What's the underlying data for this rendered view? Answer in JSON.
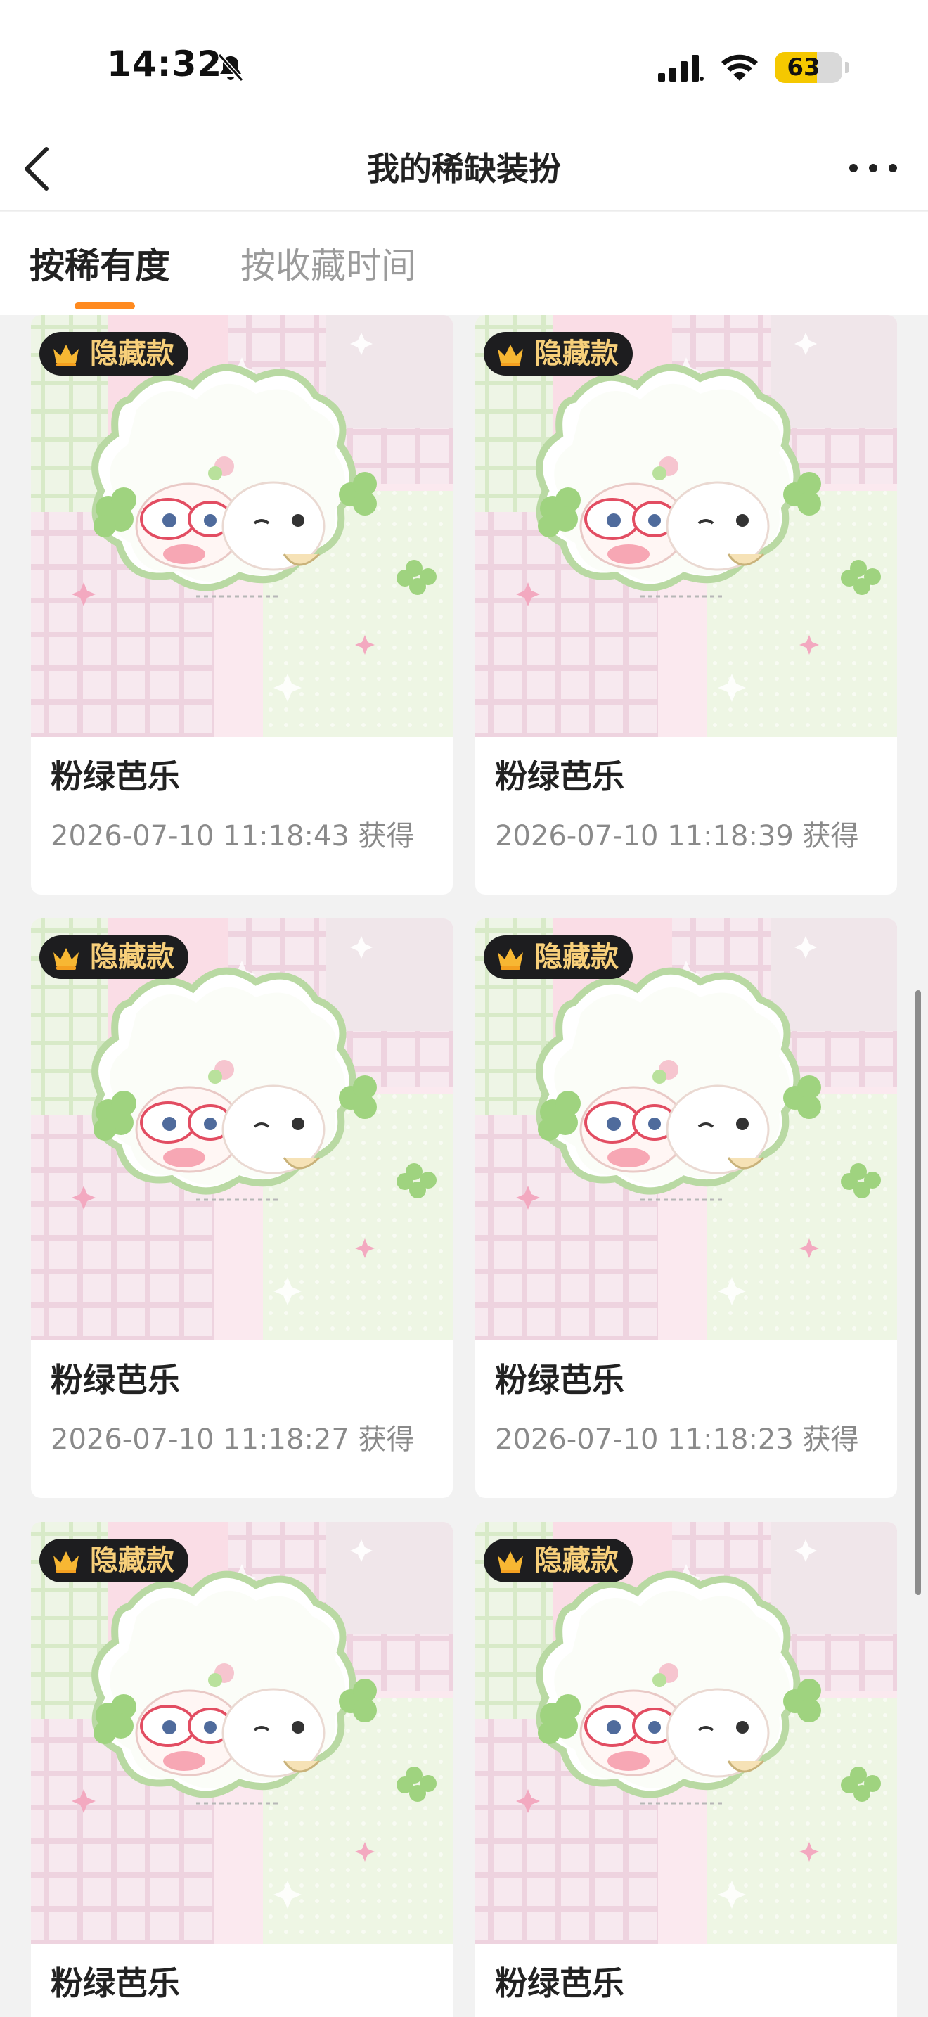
{
  "status_bar": {
    "time": "14:32",
    "battery": "63",
    "battery_level": 0.63,
    "icons": [
      "bell-slash-icon",
      "signal-icon",
      "wifi-icon",
      "battery-icon"
    ]
  },
  "nav": {
    "title": "我的稀缺装扮",
    "back_icon": "chevron-left-icon",
    "more_icon": "more-horizontal-icon"
  },
  "tabs": [
    {
      "label": "按稀有度",
      "active": true
    },
    {
      "label": "按收藏时间",
      "active": false
    }
  ],
  "accent_color": "#ff8a1f",
  "badge_color": "#f7cf7a",
  "items": [
    {
      "badge": "隐藏款",
      "name": "粉绿芭乐",
      "date": "2026-07-10 11:18:43 获得"
    },
    {
      "badge": "隐藏款",
      "name": "粉绿芭乐",
      "date": "2026-07-10 11:18:39 获得"
    },
    {
      "badge": "隐藏款",
      "name": "粉绿芭乐",
      "date": "2026-07-10 11:18:27 获得"
    },
    {
      "badge": "隐藏款",
      "name": "粉绿芭乐",
      "date": "2026-07-10 11:18:23 获得"
    },
    {
      "badge": "隐藏款",
      "name": "粉绿芭乐",
      "date": ""
    },
    {
      "badge": "隐藏款",
      "name": "粉绿芭乐",
      "date": ""
    }
  ]
}
